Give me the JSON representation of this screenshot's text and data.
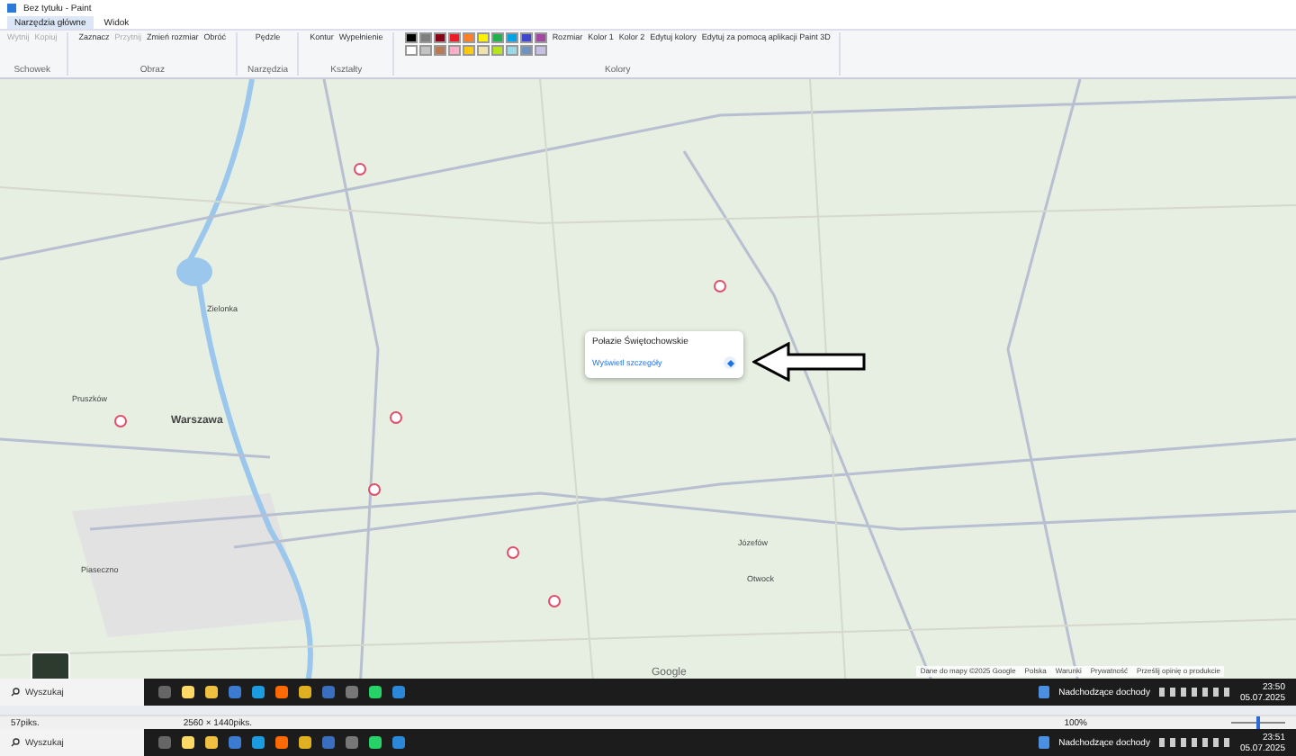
{
  "window": {
    "title": "Bez tytułu - Paint"
  },
  "tabs": [
    {
      "label": "Narzędzia główne",
      "selected": true
    },
    {
      "label": "Widok",
      "selected": false
    }
  ],
  "ribbon": {
    "groups": [
      {
        "label": "Schowek",
        "items": [
          {
            "label": "Wytnij",
            "disabled": true
          },
          {
            "label": "Kopiuj",
            "disabled": true
          }
        ]
      },
      {
        "label": "Obraz",
        "items": [
          {
            "label": "Zaznacz",
            "disabled": false
          },
          {
            "label": "Przytnij",
            "disabled": true
          },
          {
            "label": "Zmień rozmiar",
            "disabled": false
          },
          {
            "label": "Obróć",
            "disabled": false
          }
        ]
      },
      {
        "label": "Narzędzia",
        "items": [
          {
            "label": "Pędzle",
            "disabled": false
          }
        ]
      },
      {
        "label": "Kształty",
        "items": [
          {
            "label": "Kontur",
            "disabled": false
          },
          {
            "label": "Wypełnienie",
            "disabled": false
          }
        ]
      },
      {
        "label": "Kolory",
        "items": [
          {
            "label": "Rozmiar",
            "disabled": false
          },
          {
            "label": "Kolor 1",
            "disabled": false
          },
          {
            "label": "Kolor 2",
            "disabled": false
          },
          {
            "label": "Edytuj kolory",
            "disabled": false
          },
          {
            "label": "Edytuj za pomocą aplikacji Paint 3D",
            "disabled": false
          }
        ]
      }
    ],
    "palette": [
      {
        "color": "#000000"
      },
      {
        "color": "#7f7f7f"
      },
      {
        "color": "#880015"
      },
      {
        "color": "#ed1c24"
      },
      {
        "color": "#ff7f27"
      },
      {
        "color": "#fff200"
      },
      {
        "color": "#22b14c"
      },
      {
        "color": "#00a2e8"
      },
      {
        "color": "#3f48cc"
      },
      {
        "color": "#a349a4"
      },
      {
        "color": "#ffffff"
      },
      {
        "color": "#c3c3c3"
      },
      {
        "color": "#b97a57"
      },
      {
        "color": "#ffaec9"
      },
      {
        "color": "#ffc90e"
      },
      {
        "color": "#efe4b0"
      },
      {
        "color": "#b5e61d"
      },
      {
        "color": "#99d9ea"
      },
      {
        "color": "#7092be"
      },
      {
        "color": "#c8bfe7"
      }
    ]
  },
  "map": {
    "places": [
      {
        "name": "Warszawa",
        "kind": "city"
      },
      {
        "name": "Józefów",
        "kind": "town"
      },
      {
        "name": "Otwock",
        "kind": "town"
      },
      {
        "name": "Piaseczno",
        "kind": "town"
      },
      {
        "name": "Zielonka",
        "kind": "town"
      },
      {
        "name": "Pruszków",
        "kind": "town"
      }
    ],
    "popup": {
      "title": "Połazie Świętochowskie",
      "link": "Wyświetl szczegóły"
    },
    "logo": "Google",
    "footer": [
      "Dane do mapy ©2025 Google",
      "Polska",
      "Warunki",
      "Prywatność",
      "Prześlij opinię o produkcie"
    ]
  },
  "inner_taskbar": {
    "search": "Wyszukaj",
    "widget": "Nadchodzące dochody",
    "time": "23:50",
    "date": "05.07.2025"
  },
  "status_bar": {
    "position": "57piks.",
    "size": "2560 × 1440piks.",
    "zoom": "100%",
    "level": 0.5
  },
  "taskbar": {
    "search": "Wyszukaj",
    "widget": "Nadchodzące dochody",
    "time": "23:51",
    "date": "05.07.2025"
  }
}
